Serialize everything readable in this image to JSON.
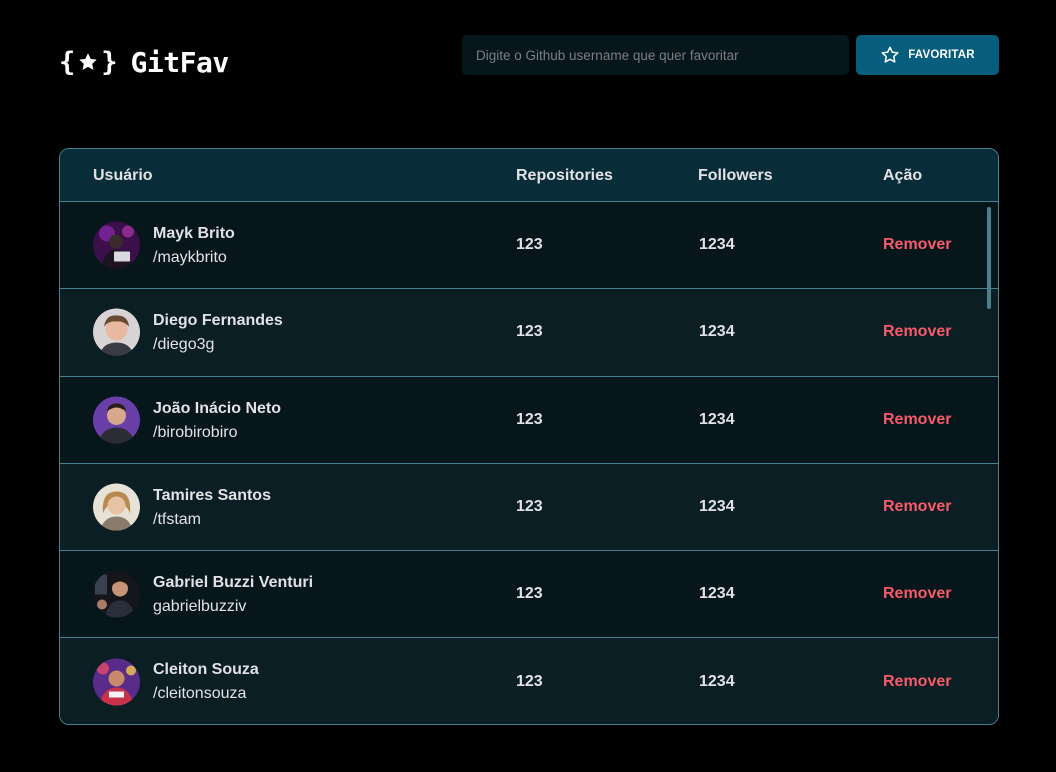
{
  "header": {
    "logo_text": "GitFav",
    "search_placeholder": "Digite o Github username que quer favoritar",
    "search_value": "",
    "favorite_button_label": "FAVORITAR"
  },
  "table": {
    "columns": {
      "user": "Usuário",
      "repositories": "Repositories",
      "followers": "Followers",
      "action": "Ação"
    },
    "rows": [
      {
        "name": "Mayk Brito",
        "login": "/maykbrito",
        "repositories": "123",
        "followers": "1234",
        "action": "Remover"
      },
      {
        "name": "Diego Fernandes",
        "login": "/diego3g",
        "repositories": "123",
        "followers": "1234",
        "action": "Remover"
      },
      {
        "name": "João Inácio Neto",
        "login": "/birobirobiro",
        "repositories": "123",
        "followers": "1234",
        "action": "Remover"
      },
      {
        "name": "Tamires Santos",
        "login": "/tfstam",
        "repositories": "123",
        "followers": "1234",
        "action": "Remover"
      },
      {
        "name": "Gabriel Buzzi Venturi",
        "login": "gabrielbuzziv",
        "repositories": "123",
        "followers": "1234",
        "action": "Remover"
      },
      {
        "name": "Cleiton Souza",
        "login": "/cleitonsouza",
        "repositories": "123",
        "followers": "1234",
        "action": "Remover"
      }
    ]
  },
  "colors": {
    "background": "#000000",
    "header_row": "#092D38",
    "row_odd": "#06161B",
    "row_even": "#0A1E24",
    "border": "#4A808C",
    "accent_button": "#065E7C",
    "remove_text": "#F75A68"
  },
  "icons": {
    "logo": "star-in-braces-icon",
    "favorite_button": "star-outline-icon"
  }
}
